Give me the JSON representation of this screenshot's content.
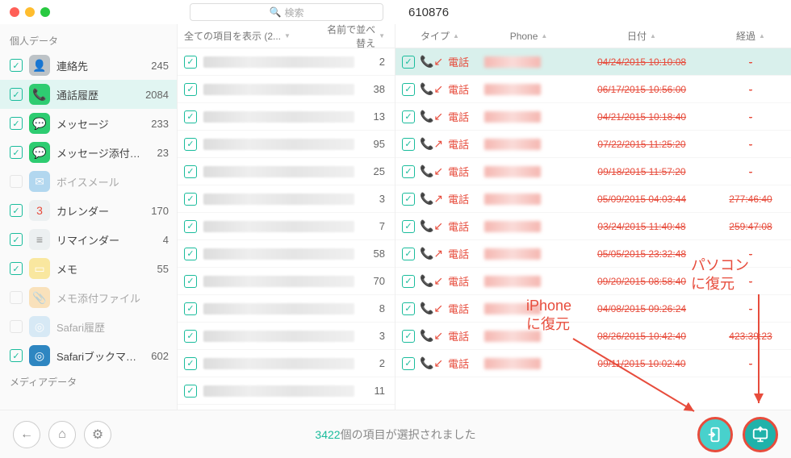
{
  "search_placeholder": "検索",
  "header_title": "610876",
  "sidebar": {
    "section1": "個人データ",
    "section2": "メディアデータ",
    "items": [
      {
        "label": "連絡先",
        "count": "245",
        "bg": "#bdc3c7",
        "glyph": "👤",
        "checked": true
      },
      {
        "label": "通話履歴",
        "count": "2084",
        "bg": "#2ecc71",
        "glyph": "📞",
        "checked": true,
        "sel": true
      },
      {
        "label": "メッセージ",
        "count": "233",
        "bg": "#2ecc71",
        "glyph": "💬",
        "checked": true
      },
      {
        "label": "メッセージ添付…",
        "count": "23",
        "bg": "#2ecc71",
        "glyph": "💬",
        "checked": true
      },
      {
        "label": "ボイスメール",
        "count": "",
        "bg": "#5dade2",
        "glyph": "✉",
        "checked": false,
        "dis": true
      },
      {
        "label": "カレンダー",
        "count": "170",
        "bg": "#ecf0f1",
        "glyph": "3",
        "checked": true,
        "fg": "#e74c3c"
      },
      {
        "label": "リマインダー",
        "count": "4",
        "bg": "#ecf0f1",
        "glyph": "≡",
        "checked": true,
        "fg": "#888"
      },
      {
        "label": "メモ",
        "count": "55",
        "bg": "#f9e79f",
        "glyph": "▭",
        "checked": true
      },
      {
        "label": "メモ添付ファイル",
        "count": "",
        "bg": "#f8c471",
        "glyph": "📎",
        "checked": false,
        "dis": true
      },
      {
        "label": "Safari履歴",
        "count": "",
        "bg": "#aed6f1",
        "glyph": "◎",
        "checked": false,
        "dis": true
      },
      {
        "label": "Safariブックマ…",
        "count": "602",
        "bg": "#2e86c1",
        "glyph": "◎",
        "checked": true
      }
    ]
  },
  "mid_headers": {
    "col1": "全ての項目を表示 (2...",
    "col2": "名前で並べ替え"
  },
  "mid_rows": [
    {
      "c": "2"
    },
    {
      "c": "38"
    },
    {
      "c": "13"
    },
    {
      "c": "95"
    },
    {
      "c": "25"
    },
    {
      "c": "3"
    },
    {
      "c": "7"
    },
    {
      "c": "58"
    },
    {
      "c": "70"
    },
    {
      "c": "8"
    },
    {
      "c": "3"
    },
    {
      "c": "2"
    },
    {
      "c": "11"
    }
  ],
  "right_headers": {
    "type": "タイプ",
    "phone": "Phone",
    "date": "日付",
    "dur": "経過"
  },
  "call_label": "電話",
  "right_rows": [
    {
      "icon": "in",
      "date": "04/24/2015 10:10:08",
      "dur": "-",
      "hl": true
    },
    {
      "icon": "in",
      "date": "06/17/2015 10:56:00",
      "dur": "-"
    },
    {
      "icon": "in",
      "date": "04/21/2015 10:18:40",
      "dur": "-"
    },
    {
      "icon": "out",
      "date": "07/22/2015 11:25:20",
      "dur": "-"
    },
    {
      "icon": "in",
      "date": "09/18/2015 11:57:20",
      "dur": "-"
    },
    {
      "icon": "out",
      "date": "05/09/2015 04:03:44",
      "dur": "277:46:40"
    },
    {
      "icon": "in",
      "date": "03/24/2015 11:40:48",
      "dur": "259:47:08"
    },
    {
      "icon": "out",
      "date": "05/05/2015 23:32:48",
      "dur": "-"
    },
    {
      "icon": "in",
      "date": "09/20/2015 08:58:40",
      "dur": "-"
    },
    {
      "icon": "in",
      "date": "04/08/2015 09:26:24",
      "dur": "-"
    },
    {
      "icon": "in",
      "date": "08/26/2015 10:42:40",
      "dur": "423:39:23"
    },
    {
      "icon": "in",
      "date": "09/11/2015 10:02:40",
      "dur": "-"
    }
  ],
  "status_count": "3422",
  "status_suffix": "個の項目が選択されました",
  "anno1": "iPhone\nに復元",
  "anno2": "パソコン\nに復元"
}
